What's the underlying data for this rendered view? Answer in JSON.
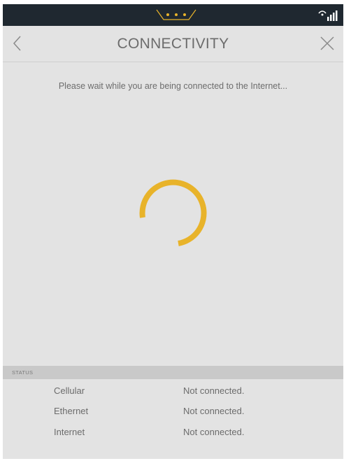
{
  "header": {
    "title": "CONNECTIVITY",
    "back_icon": "chevron-left-icon",
    "close_icon": "close-icon"
  },
  "main": {
    "message": "Please wait while you are being connected to the Internet..."
  },
  "status": {
    "heading": "STATUS",
    "rows": [
      {
        "label": "Cellular",
        "value": "Not connected."
      },
      {
        "label": "Ethernet",
        "value": "Not connected."
      },
      {
        "label": "Internet",
        "value": "Not connected."
      }
    ]
  },
  "colors": {
    "accent": "#e8b32a",
    "background": "#e3e3e3",
    "status_bar": "#1f2830"
  }
}
